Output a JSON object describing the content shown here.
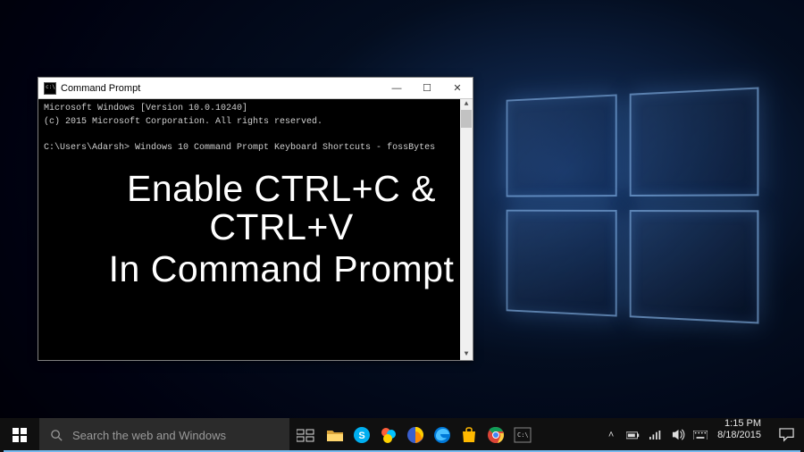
{
  "desktop": {},
  "cmd": {
    "title": "Command Prompt",
    "line1": "Microsoft Windows [Version 10.0.10240]",
    "line2": "(c) 2015 Microsoft Corporation. All rights reserved.",
    "prompt_path": "C:\\Users\\Adarsh>",
    "typed_text": " Windows 10 Command Prompt Keyboard Shortcuts - fossBytes",
    "btn_min": "—",
    "btn_max": "☐",
    "btn_close": "✕",
    "scroll_up": "▲",
    "scroll_dn": "▼"
  },
  "caption": {
    "line1": "Enable CTRL+C & CTRL+V",
    "line2": "In Command Prompt"
  },
  "taskbar": {
    "search_placeholder": "Search the web and Windows",
    "tray_chevron": "˄",
    "time": "1:15 PM",
    "date": "8/18/2015"
  }
}
